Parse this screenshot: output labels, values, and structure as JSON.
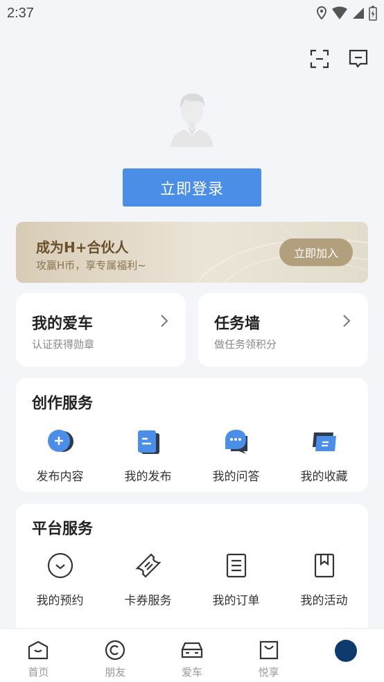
{
  "status_bar": {
    "time": "2:37"
  },
  "header": {
    "scan_icon": "scan-icon",
    "message_icon": "message-icon"
  },
  "login": {
    "button_label": "立即登录"
  },
  "partner": {
    "title": "成为H+合伙人",
    "subtitle": "攻赢H币，享专属福利~",
    "join_label": "立即加入"
  },
  "quick_cards": [
    {
      "title": "我的爱车",
      "subtitle": "认证获得勋章"
    },
    {
      "title": "任务墙",
      "subtitle": "做任务领积分"
    }
  ],
  "creation_services": {
    "title": "创作服务",
    "items": [
      {
        "label": "发布内容",
        "icon": "plus-circle-icon"
      },
      {
        "label": "我的发布",
        "icon": "document-icon"
      },
      {
        "label": "我的问答",
        "icon": "chat-bubble-icon"
      },
      {
        "label": "我的收藏",
        "icon": "collection-icon"
      }
    ]
  },
  "platform_services": {
    "title": "平台服务",
    "items": [
      {
        "label": "我的预约",
        "icon": "appointment-icon"
      },
      {
        "label": "卡券服务",
        "icon": "ticket-icon"
      },
      {
        "label": "我的订单",
        "icon": "order-list-icon"
      },
      {
        "label": "我的活动",
        "icon": "bookmark-icon"
      }
    ]
  },
  "tabbar": {
    "tabs": [
      {
        "label": "首页",
        "icon": "home-icon"
      },
      {
        "label": "朋友",
        "icon": "friends-icon"
      },
      {
        "label": "爱车",
        "icon": "car-icon"
      },
      {
        "label": "悦享",
        "icon": "shopping-bag-icon"
      },
      {
        "label": "",
        "icon": "profile-avatar"
      }
    ]
  },
  "colors": {
    "primary_blue": "#4a8ee8",
    "partner_gold": "#b29f7d",
    "background": "#f4f5f9",
    "active_tab": "#0e3a6e"
  }
}
